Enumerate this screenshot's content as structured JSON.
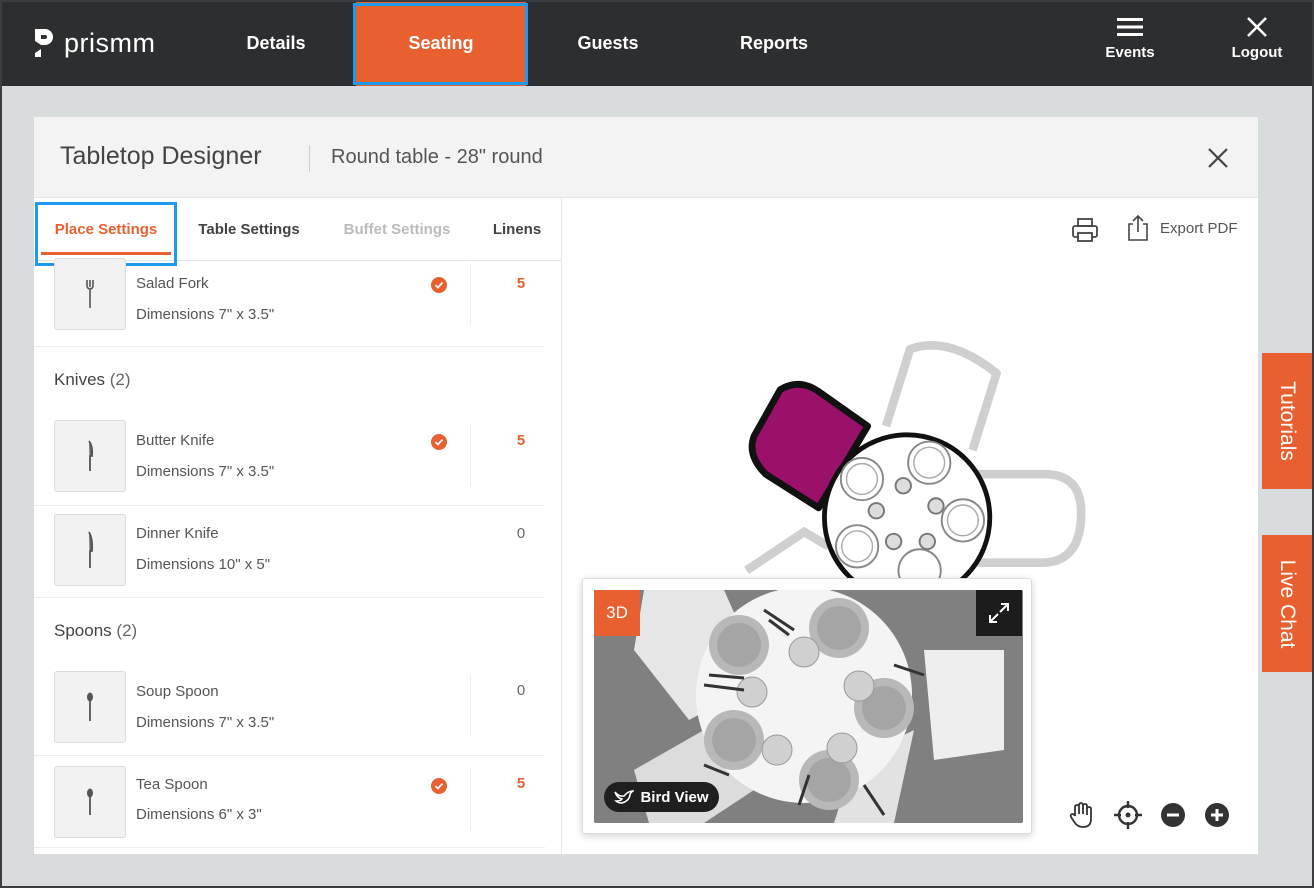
{
  "app": {
    "logo_text": "prismm"
  },
  "nav": {
    "items": [
      {
        "label": "Details"
      },
      {
        "label": "Seating",
        "active": true
      },
      {
        "label": "Guests"
      },
      {
        "label": "Reports"
      }
    ],
    "events_label": "Events",
    "logout_label": "Logout"
  },
  "panel": {
    "title": "Tabletop Designer",
    "subtitle": "Round table - 28\" round"
  },
  "tabs": [
    {
      "label": "Place Settings",
      "state": "active"
    },
    {
      "label": "Table Settings",
      "state": "normal"
    },
    {
      "label": "Buffet Settings",
      "state": "disabled"
    },
    {
      "label": "Linens",
      "state": "normal"
    }
  ],
  "items": {
    "salad_fork": {
      "name": "Salad Fork",
      "dims": "Dimensions 7\" x 3.5\"",
      "qty": "5",
      "selected": true
    },
    "butter_knife": {
      "name": "Butter Knife",
      "dims": "Dimensions 7\" x 3.5\"",
      "qty": "5",
      "selected": true
    },
    "dinner_knife": {
      "name": "Dinner Knife",
      "dims": "Dimensions 10\" x 5\"",
      "qty": "0",
      "selected": false
    },
    "soup_spoon": {
      "name": "Soup Spoon",
      "dims": "Dimensions 7\" x 3.5\"",
      "qty": "0",
      "selected": false
    },
    "tea_spoon": {
      "name": "Tea Spoon",
      "dims": "Dimensions 6\" x 3\"",
      "qty": "5",
      "selected": true
    }
  },
  "sections": {
    "knives": {
      "label": "Knives",
      "count": "(2)"
    },
    "spoons": {
      "label": "Spoons",
      "count": "(2)"
    }
  },
  "toolbar": {
    "export_label": "Export PDF"
  },
  "view3d": {
    "badge": "3D",
    "bird_view_label": "Bird View"
  },
  "side_tabs": {
    "tutorials": "Tutorials",
    "live_chat": "Live Chat"
  },
  "colors": {
    "accent": "#e8602f",
    "topbar": "#2c2e30",
    "highlight": "#1e9bef",
    "selected_chair": "#9b1069"
  }
}
